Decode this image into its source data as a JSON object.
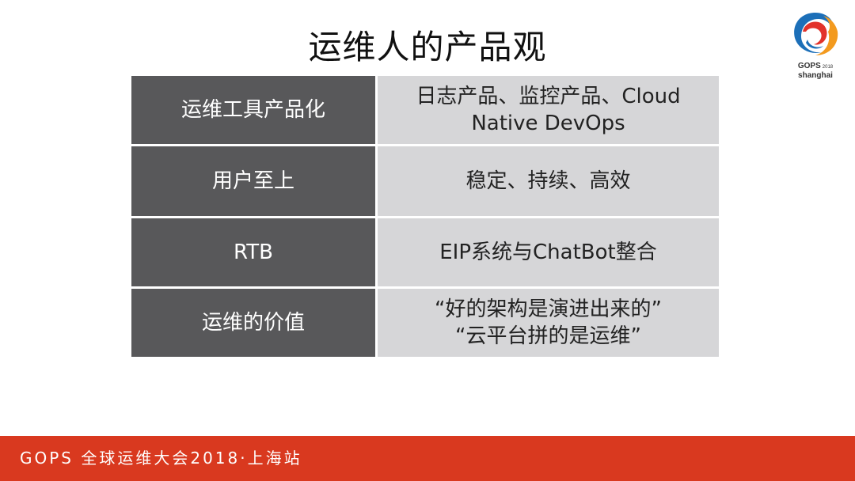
{
  "slide": {
    "title": "运维人的产品观"
  },
  "logo": {
    "brand": "GOPS",
    "year": "2018",
    "city": "shanghai",
    "colors": [
      "#1c6fb8",
      "#e2322a",
      "#f39a1e"
    ]
  },
  "table": {
    "rows": [
      {
        "label": "运维工具产品化",
        "value_lines": [
          "日志产品、监控产品、Cloud",
          "Native DevOps"
        ]
      },
      {
        "label": "用户至上",
        "value_lines": [
          "稳定、持续、高效"
        ]
      },
      {
        "label": "RTB",
        "value_lines": [
          "EIP系统与ChatBot整合"
        ]
      },
      {
        "label": "运维的价值",
        "value_lines": [
          "“好的架构是演进出来的”",
          "“云平台拼的是运维”"
        ]
      }
    ]
  },
  "footer": {
    "text": "GOPS 全球运维大会2018·上海站"
  },
  "colors": {
    "label_bg": "#58585a",
    "value_bg": "#d6d6d8",
    "footer_bg": "#d9391f"
  }
}
